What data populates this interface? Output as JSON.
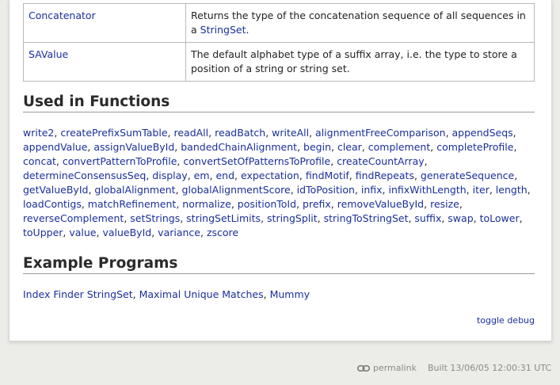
{
  "types_table": {
    "rows": [
      {
        "name": "Concatenator",
        "description_before": "Returns the type of the concatenation sequence of all sequences in a ",
        "description_link": "StringSet",
        "description_after": "."
      },
      {
        "name": "SAValue",
        "description": "The default alphabet type of a suffix array, i.e. the type to store a position of a string or string set."
      }
    ]
  },
  "used_in_functions": {
    "heading": "Used in Functions",
    "items": [
      "write2",
      "createPrefixSumTable",
      "readAll",
      "readBatch",
      "writeAll",
      "alignmentFreeComparison",
      "appendSeqs",
      "appendValue",
      "assignValueById",
      "bandedChainAlignment",
      "begin",
      "clear",
      "complement",
      "completeProfile",
      "concat",
      "convertPatternToProfile",
      "convertSetOfPatternsToProfile",
      "createCountArray",
      "determineConsensusSeq",
      "display",
      "em",
      "end",
      "expectation",
      "findMotif",
      "findRepeats",
      "generateSequence",
      "getValueById",
      "globalAlignment",
      "globalAlignmentScore",
      "idToPosition",
      "infix",
      "infixWithLength",
      "iter",
      "length",
      "loadContigs",
      "matchRefinement",
      "normalize",
      "positionToId",
      "prefix",
      "removeValueById",
      "resize",
      "reverseComplement",
      "setStrings",
      "stringSetLimits",
      "stringSplit",
      "stringToStringSet",
      "suffix",
      "swap",
      "toLower",
      "toUpper",
      "value",
      "valueById",
      "variance",
      "zscore"
    ]
  },
  "example_programs": {
    "heading": "Example Programs",
    "items": [
      "Index Finder StringSet",
      "Maximal Unique Matches",
      "Mummy"
    ]
  },
  "toggle_debug": "toggle debug",
  "footer": {
    "permalink_label": "permalink",
    "built": "Built 13/06/05 12:00:31 UTC"
  },
  "icons": {
    "permalink": "link-icon"
  },
  "colors": {
    "link": "#1a2f9a",
    "background": "#ecece8"
  }
}
